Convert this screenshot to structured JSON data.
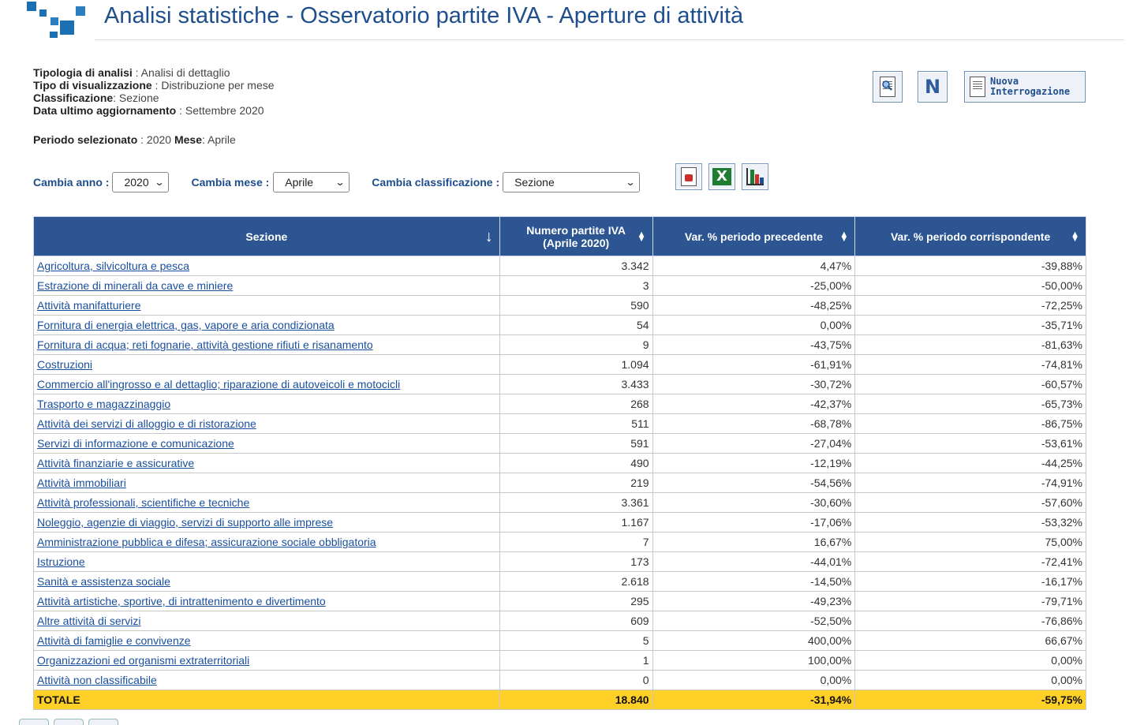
{
  "header": {
    "title": "Analisi statistiche - Osservatorio partite IVA - Aperture di attività"
  },
  "info": {
    "tipologia_label": "Tipologia di analisi",
    "tipologia_value": " : Analisi di dettaglio",
    "tipo_vis_label": "Tipo di visualizzazione",
    "tipo_vis_value": " : Distribuzione per mese",
    "classificazione_label": "Classificazione",
    "classificazione_value": ": Sezione",
    "data_label": "Data ultimo aggiornamento",
    "data_value": " : Settembre 2020",
    "periodo_label": "Periodo selezionato",
    "periodo_value": " : 2020 ",
    "mese_label": "Mese",
    "mese_value": ": Aprile"
  },
  "toolbar": {
    "nuova_line1": "Nuova",
    "nuova_line2": "Interrogazione",
    "n_label": "N"
  },
  "controls": {
    "anno_label": "Cambia anno :",
    "anno_value": "2020",
    "mese_label": "Cambia mese :",
    "mese_value": "Aprile",
    "classificazione_label": "Cambia classificazione :",
    "classificazione_value": "Sezione"
  },
  "table": {
    "headers": {
      "sezione": "Sezione",
      "numero_line1": "Numero partite IVA",
      "numero_line2": "(Aprile 2020)",
      "var_prec": "Var. % periodo precedente",
      "var_corr": "Var. % periodo corrispondente"
    },
    "rows": [
      {
        "sezione": "Agricoltura, silvicoltura e pesca",
        "numero": "3.342",
        "var_prec": "4,47%",
        "var_corr": "-39,88%"
      },
      {
        "sezione": "Estrazione di minerali da cave e miniere",
        "numero": "3",
        "var_prec": "-25,00%",
        "var_corr": "-50,00%"
      },
      {
        "sezione": "Attività manifatturiere",
        "numero": "590",
        "var_prec": "-48,25%",
        "var_corr": "-72,25%"
      },
      {
        "sezione": "Fornitura di energia elettrica, gas, vapore e aria condizionata",
        "numero": "54",
        "var_prec": "0,00%",
        "var_corr": "-35,71%"
      },
      {
        "sezione": "Fornitura di acqua; reti fognarie, attività gestione rifiuti e risanamento",
        "numero": "9",
        "var_prec": "-43,75%",
        "var_corr": "-81,63%"
      },
      {
        "sezione": "Costruzioni",
        "numero": "1.094",
        "var_prec": "-61,91%",
        "var_corr": "-74,81%"
      },
      {
        "sezione": "Commercio all'ingrosso e al dettaglio; riparazione di autoveicoli e motocicli",
        "numero": "3.433",
        "var_prec": "-30,72%",
        "var_corr": "-60,57%"
      },
      {
        "sezione": "Trasporto e magazzinaggio",
        "numero": "268",
        "var_prec": "-42,37%",
        "var_corr": "-65,73%"
      },
      {
        "sezione": "Attività dei servizi di alloggio e di ristorazione",
        "numero": "511",
        "var_prec": "-68,78%",
        "var_corr": "-86,75%"
      },
      {
        "sezione": "Servizi di informazione e comunicazione",
        "numero": "591",
        "var_prec": "-27,04%",
        "var_corr": "-53,61%"
      },
      {
        "sezione": "Attività finanziarie e assicurative",
        "numero": "490",
        "var_prec": "-12,19%",
        "var_corr": "-44,25%"
      },
      {
        "sezione": "Attività immobiliari",
        "numero": "219",
        "var_prec": "-54,56%",
        "var_corr": "-74,91%"
      },
      {
        "sezione": "Attività professionali, scientifiche e tecniche",
        "numero": "3.361",
        "var_prec": "-30,60%",
        "var_corr": "-57,60%"
      },
      {
        "sezione": "Noleggio, agenzie di viaggio, servizi di supporto alle imprese",
        "numero": "1.167",
        "var_prec": "-17,06%",
        "var_corr": "-53,32%"
      },
      {
        "sezione": "Amministrazione pubblica e difesa; assicurazione sociale obbligatoria",
        "numero": "7",
        "var_prec": "16,67%",
        "var_corr": "75,00%"
      },
      {
        "sezione": "Istruzione",
        "numero": "173",
        "var_prec": "-44,01%",
        "var_corr": "-72,41%"
      },
      {
        "sezione": "Sanità e assistenza sociale",
        "numero": "2.618",
        "var_prec": "-14,50%",
        "var_corr": "-16,17%"
      },
      {
        "sezione": "Attività artistiche, sportive, di intrattenimento e divertimento",
        "numero": "295",
        "var_prec": "-49,23%",
        "var_corr": "-79,71%"
      },
      {
        "sezione": "Altre attività di servizi",
        "numero": "609",
        "var_prec": "-52,50%",
        "var_corr": "-76,86%"
      },
      {
        "sezione": "Attività di famiglie e convivenze",
        "numero": "5",
        "var_prec": "400,00%",
        "var_corr": "66,67%"
      },
      {
        "sezione": "Organizzazioni ed organismi extraterritoriali",
        "numero": "1",
        "var_prec": "100,00%",
        "var_corr": "0,00%"
      },
      {
        "sezione": "Attività non classificabile",
        "numero": "0",
        "var_prec": "0,00%",
        "var_corr": "0,00%"
      }
    ],
    "total": {
      "label": "TOTALE",
      "numero": "18.840",
      "var_prec": "-31,94%",
      "var_corr": "-59,75%"
    }
  },
  "colors": {
    "header_bg": "#2d5591",
    "title": "#1f4e8c",
    "link": "#1a4f9c",
    "total_bg": "#ffd027"
  },
  "icons": {
    "logo": "squares-logo-icon",
    "magnify": "document-search-icon",
    "n": "letter-n-icon",
    "nuova": "new-query-document-icon",
    "pdf": "pdf-export-icon",
    "excel": "excel-export-icon",
    "chart": "bar-chart-icon"
  }
}
